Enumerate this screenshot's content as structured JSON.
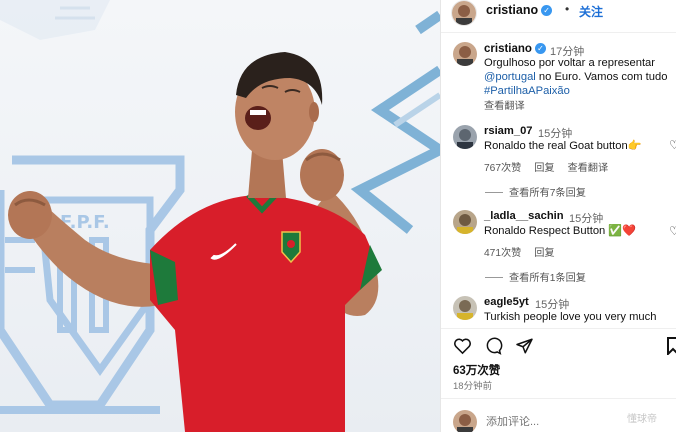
{
  "header": {
    "username": "cristiano",
    "separator": "•",
    "follow_label": "关注"
  },
  "caption": {
    "username": "cristiano",
    "time": "17分钟",
    "line1": "Orgulhoso por voltar a representar",
    "mention": "@portugal",
    "line2_rest": " no Euro. Vamos com tudo",
    "hashtag": "#PartilhaAPaixão",
    "translate": "查看翻译"
  },
  "comments": [
    {
      "username": "rsiam_07",
      "time": "15分钟",
      "text": "Ronaldo the real Goat button👉",
      "likes": "767次赞",
      "reply": "回复",
      "translate": "查看翻译",
      "view_replies": "查看所有7条回复"
    },
    {
      "username": "_ladla__sachin",
      "time": "15分钟",
      "text": "Ronaldo Respect Button ✅❤️",
      "likes": "471次赞",
      "reply": "回复",
      "view_replies": "查看所有1条回复"
    },
    {
      "username": "eagle5yt",
      "time": "15分钟",
      "text": "Turkish people love you very much"
    }
  ],
  "actions": {
    "like_icon": "heart-icon",
    "comment_icon": "comment-icon",
    "share_icon": "share-icon",
    "save_icon": "bookmark-icon"
  },
  "post_stats": {
    "likes": "63万次赞",
    "posted": "18分钟前"
  },
  "add_comment": {
    "placeholder": "添加评论..."
  },
  "photo": {
    "crest_text": "F.P.F.",
    "jersey_color": "#d81e2a",
    "accent_color": "#1e7a3b",
    "background_color": "#eef1f5",
    "crest_color": "#a9c7e6"
  },
  "watermark": "懂球帝"
}
